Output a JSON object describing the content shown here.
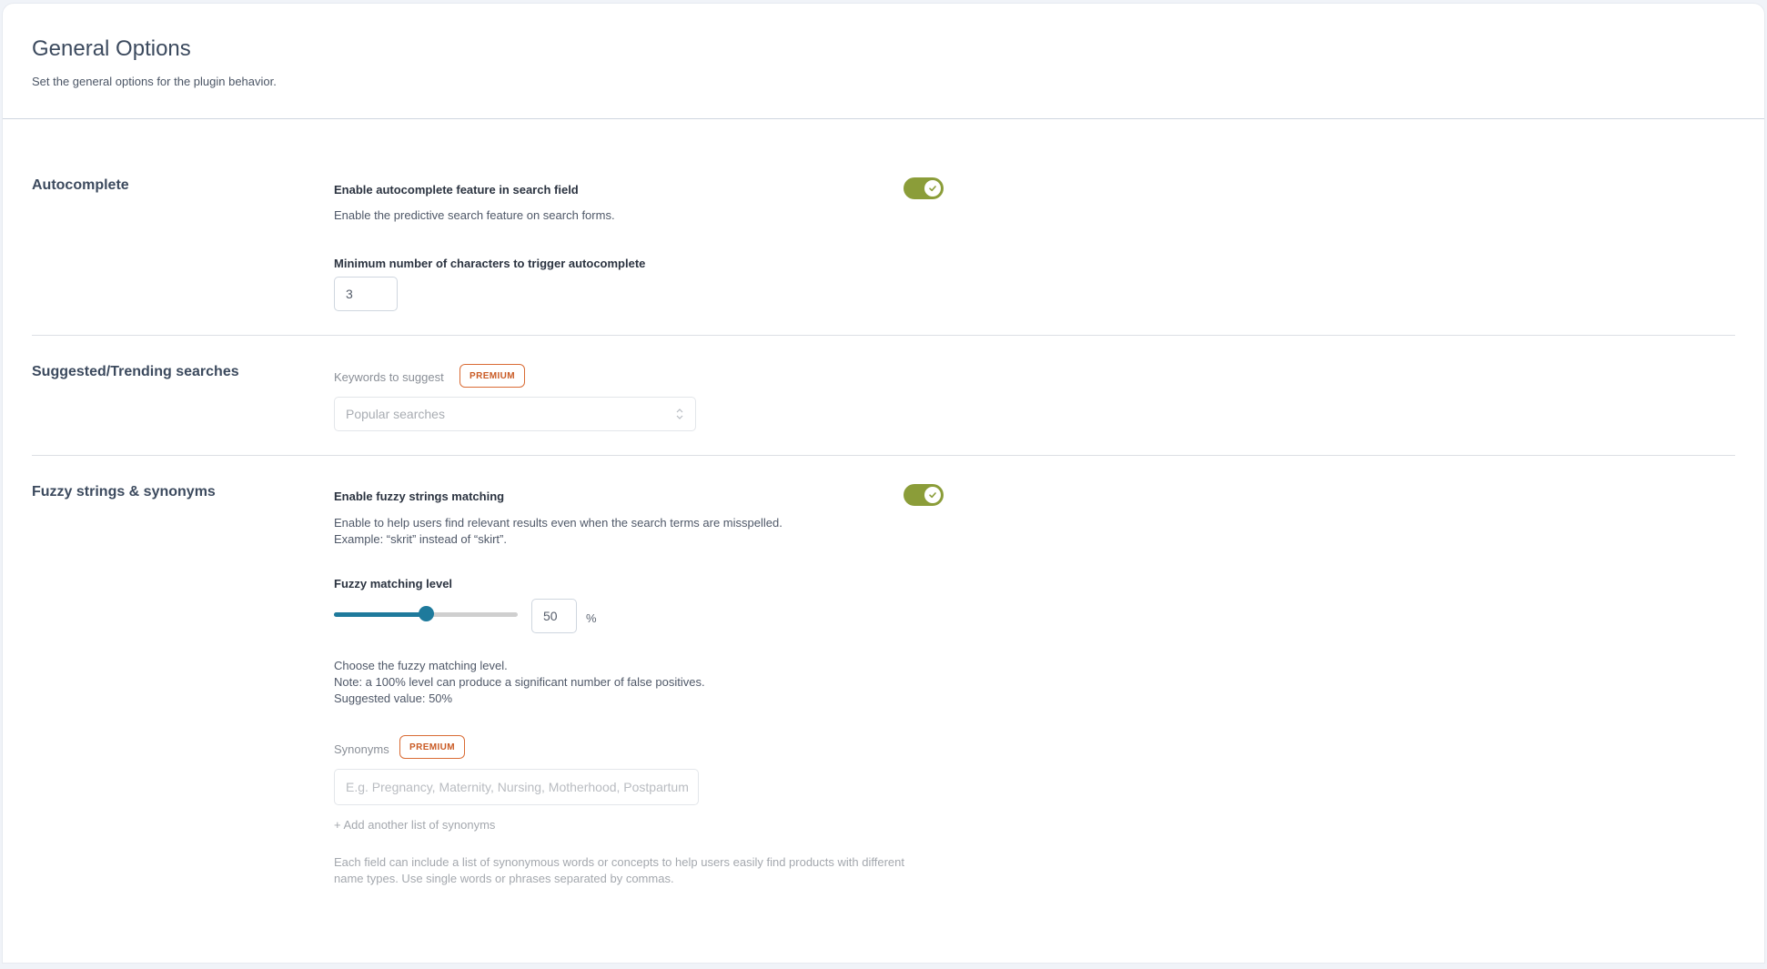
{
  "header": {
    "title": "General Options",
    "subtitle": "Set the general options for the plugin behavior."
  },
  "colors": {
    "toggle_on": "#8b9d39",
    "slider_accent": "#1e7a9c",
    "premium_badge": "#d96b34"
  },
  "sections": {
    "autocomplete": {
      "label": "Autocomplete",
      "enable_label": "Enable autocomplete feature in search field",
      "enable_description": "Enable the predictive search feature on search forms.",
      "enabled": true,
      "min_chars_label": "Minimum number of characters to trigger autocomplete",
      "min_chars_value": "3"
    },
    "suggested": {
      "label": "Suggested/Trending searches",
      "keywords_label": "Keywords to suggest",
      "badge": "PREMIUM",
      "select_value": "Popular searches",
      "select_icon": "chevron-up-down-icon"
    },
    "fuzzy": {
      "label": "Fuzzy strings & synonyms",
      "enable_label": "Enable fuzzy strings matching",
      "enable_description_line1": "Enable to help users find relevant results even when the search terms are misspelled.",
      "enable_description_line2": "Example: “skrit” instead of “skirt”.",
      "enabled": true,
      "level_label": "Fuzzy matching level",
      "level_value": "50",
      "level_percent": 50,
      "level_unit": "%",
      "level_note_line1": "Choose the fuzzy matching level.",
      "level_note_line2": "Note: a 100% level can produce a significant number of false positives.",
      "level_note_line3": "Suggested value: 50%",
      "synonyms_label": "Synonyms",
      "synonyms_badge": "PREMIUM",
      "synonyms_placeholder": "E.g. Pregnancy, Maternity, Nursing, Motherhood, Postpartum",
      "add_synonyms_link": "+ Add another list of synonyms",
      "synonyms_help_line1": "Each field can include a list of synonymous words or concepts to help users easily find products with different",
      "synonyms_help_line2": "name types. Use single words or phrases separated by commas."
    }
  }
}
